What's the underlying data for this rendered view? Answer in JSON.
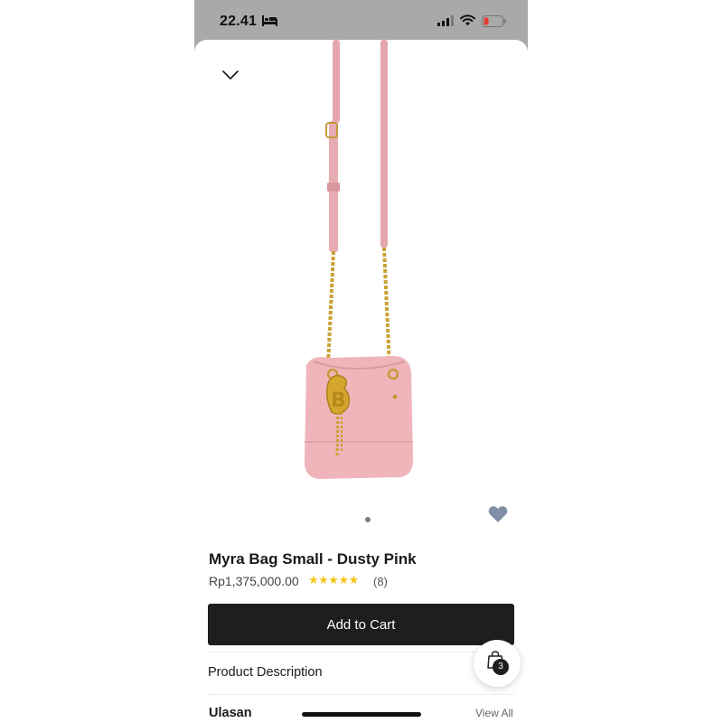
{
  "status_bar": {
    "time": "22.41",
    "icons": [
      "bed-icon",
      "cellular-signal-icon",
      "wifi-icon",
      "battery-low-icon"
    ]
  },
  "sheet": {
    "collapse_icon": "chevron-down-icon",
    "product_image": "pink-bucket-bag-with-gold-chain-strap",
    "carousel_pages": 1,
    "wishlist_icon": "heart-icon",
    "wishlist_color": "#7f8fa6"
  },
  "product": {
    "title": "Myra Bag Small - Dusty Pink",
    "price": "Rp1,375,000.00",
    "stars": "★★★★★",
    "rating_count": "(8)",
    "star_color": "#f5c518"
  },
  "actions": {
    "add_to_cart_label": "Add to Cart",
    "button_color": "#1e1e1e"
  },
  "sections": {
    "description_label": "Product Description",
    "reviews_label": "Ulasan",
    "view_all_label": "View All"
  },
  "cart": {
    "icon": "shopping-bag-icon",
    "count": "3"
  }
}
